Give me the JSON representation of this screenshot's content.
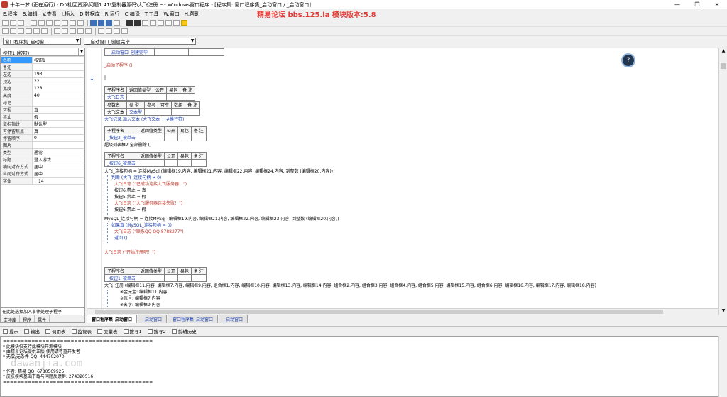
{
  "window": {
    "title": "十年一梦 (正在运行) - D:\\社区资源\\问题1.41\\复制器源码\\大飞注册.e - Windows窗口程序 - [程序集: 窗口程序集_启动窗口 / _启动窗口]",
    "min": "—",
    "max": "❐",
    "close": "✕"
  },
  "menu": [
    "E.程序",
    "B.编辑",
    "V.查看",
    "I.插入",
    "D.数据库",
    "R.运行",
    "C.编译",
    "T.工具",
    "W.窗口",
    "H.帮助"
  ],
  "banner": "精易论坛 bbs.125.la 模块版本:5.8",
  "combos": {
    "left": "窗口程序集_启动窗口",
    "right": "__启动窗口_创建完毕"
  },
  "props": {
    "header": "按钮1 (按钮)",
    "rows": [
      [
        "名称",
        "按钮1"
      ],
      [
        "备注",
        ""
      ],
      [
        "左边",
        "193"
      ],
      [
        "顶边",
        "22"
      ],
      [
        "宽度",
        "128"
      ],
      [
        "高度",
        "40"
      ],
      [
        "标记",
        ""
      ],
      [
        "可视",
        "真"
      ],
      [
        "禁止",
        "假"
      ],
      [
        "鼠标指针",
        "默认型"
      ],
      [
        "可停留焦点",
        "真"
      ],
      [
        "停留顺序",
        "0"
      ],
      [
        "图片",
        ""
      ],
      [
        "类型",
        "通常"
      ],
      [
        "标题",
        "登入游戏"
      ],
      [
        "横向对齐方式",
        "居中"
      ],
      [
        "纵向对齐方式",
        "居中"
      ],
      [
        "字体",
        "，14"
      ]
    ],
    "footer": "在此处选择加入事件处理子程序",
    "tabs": [
      "支持库",
      "程序",
      "属性"
    ]
  },
  "editor": {
    "line_top": "__启动窗口_创建完毕",
    "sub1": "_启动子程序 ()",
    "t1": {
      "h": [
        "子程序名",
        "返回值类型",
        "公开",
        "易包",
        "备 注"
      ],
      "name": "大飞日志",
      "h2": [
        "参数名",
        "类 型",
        "参考",
        "可空",
        "数组",
        "备 注"
      ],
      "p": [
        "大飞文本",
        "文本型"
      ]
    },
    "call1": "大飞记录.加入文本 (大飞文本 + #换行符)",
    "t2": {
      "h": [
        "子程序名",
        "返回值类型",
        "公开",
        "易包",
        "备 注"
      ],
      "name": "_按钮2_被单击"
    },
    "call2": "超级列表框2.全部删除 ()",
    "t3": {
      "h": [
        "子程序名",
        "返回值类型",
        "公开",
        "易包",
        "备 注"
      ],
      "name": "_按钮6_被单击"
    },
    "code1": "大飞_连接句柄 = 连接MySql (编辑框19.内容, 编辑框21.内容, 编辑框22.内容, 编辑框24.内容, 到整数 (编辑框20.内容))",
    "if1": "判断 (大飞_连接句柄 ≠ 0)",
    "l1": "大飞日志 (\"已成功连接大飞服务器！\")",
    "l2": "按钮6.禁止 = 真",
    "l3": "按钮5.禁止 = 假",
    "l4": "大飞日志 (\"大飞服务器连接失败！\")",
    "l5": "按钮6.禁止 = 假",
    "code2": "MySQL_连接句柄 = 连接MySql (编辑框19.内容, 编辑框21.内容, 编辑框22.内容, 编辑框23.内容, 到整数 (编辑框20.内容))",
    "if2": "如果真 (MySQL_连接句柄 = 0)",
    "l6": "大飞日志 (\"联系QQ QQ 8788277\")",
    "l7": "返回 ()",
    "l8": "大飞日志 (\"开始注册吧！\")",
    "t4": {
      "h": [
        "子程序名",
        "返回值类型",
        "公开",
        "易包",
        "备 注"
      ],
      "name": "_按钮1_被单击"
    },
    "code3": "大飞_注册 (编辑框11.内容, 编辑框7.内容, 编辑框9.内容, 组合框1.内容, 编辑框10.内容, 编辑框13.内容, 编辑框14.内容, 组合框2.内容, 组合框3.内容, 组合框4.内容, 组合框5.内容, 编辑框15.内容, 组合框6.内容, 编辑框16.内容, 编辑框17.内容, 编辑框18.内容)",
    "c1": "※金元宝: 编辑框11.内容",
    "c2": "※账号: 编辑框7.内容",
    "c3": "※名字: 编辑框9.内容"
  },
  "doctabs": [
    "窗口程序集_启动窗口",
    "_启动窗口",
    "窗口程序集_启动窗口",
    "_启动窗口"
  ],
  "outtabs": [
    "提示",
    "输出",
    "调用表",
    "监视表",
    "变量表",
    "搜寻1",
    "搜寻2",
    "剪辑历史"
  ],
  "output": [
    "==========================================",
    "* 此模块仅支持此模块开源模块",
    "* 由精易论坛提供正版 使用请尊重开发者",
    "* 无偿/无条件 QQ: 444702070",
    "* 作者: 精易 QQ: 6780569925",
    "* 皮肤模块基础下载与问题反馈群: 274320516",
    "=========================================="
  ],
  "watermark": "dawanjia.com",
  "help_icon": "?"
}
